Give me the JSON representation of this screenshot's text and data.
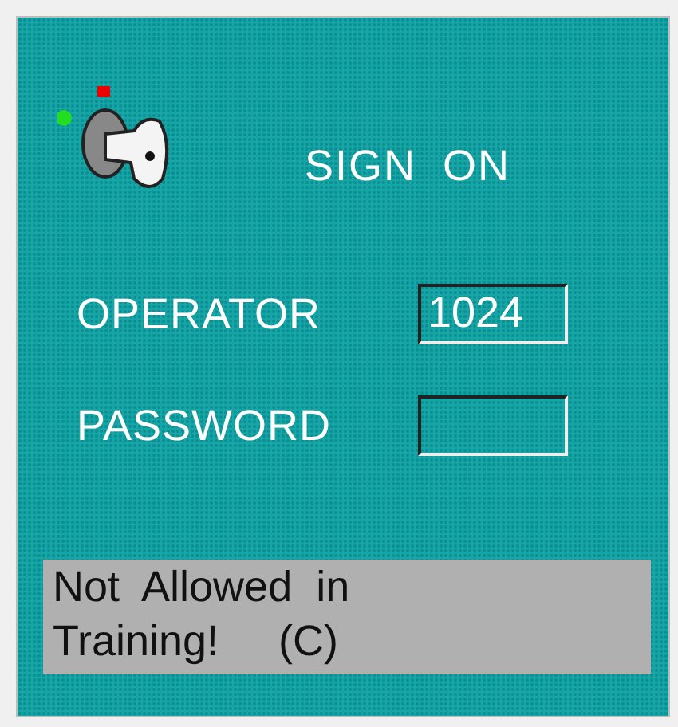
{
  "title": "SIGN ON",
  "fields": [
    {
      "label": "OPERATOR",
      "value": "1024"
    },
    {
      "label": "PASSWORD"
    }
  ],
  "message": {
    "lines": [
      "Not  Allowed  in",
      "Training!     (C)"
    ]
  }
}
